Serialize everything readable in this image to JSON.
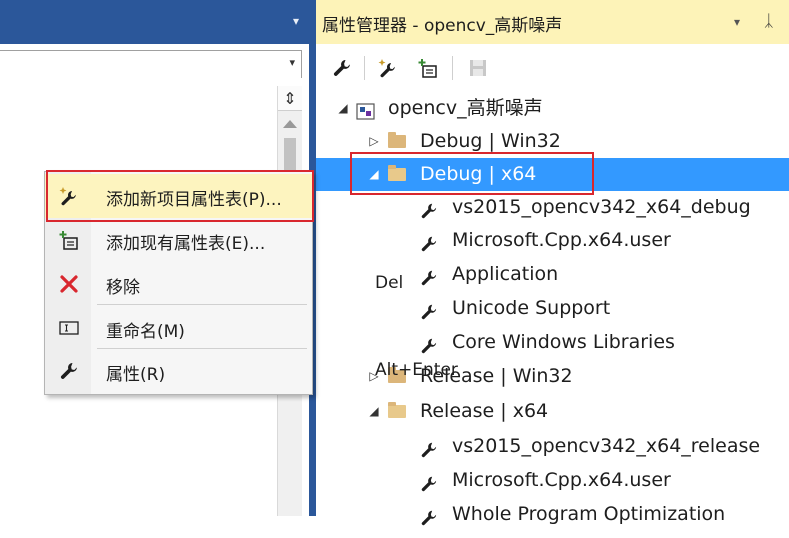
{
  "left_pane": {
    "header_dropdown": "▾",
    "combo_dropdown": "▾",
    "split_icon": "⇕"
  },
  "right_pane": {
    "title": "属性管理器 - opencv_高斯噪声",
    "title_dropdown": "▾",
    "pin": "ᛣ",
    "toolbar": [
      "wrench-icon",
      "add-new-sheet-icon",
      "add-existing-sheet-icon",
      "save-icon"
    ],
    "tree": [
      {
        "label": "opencv_高斯噪声",
        "expander": "◢",
        "icon": "project-icon"
      },
      {
        "label": "Debug | Win32",
        "expander": "▷",
        "icon": "folder-icon"
      },
      {
        "label": "Debug | x64",
        "expander": "◢",
        "icon": "folder-open-icon",
        "selected": true
      },
      {
        "label": "vs2015_opencv342_x64_debug",
        "icon": "wrench-icon"
      },
      {
        "label": "Microsoft.Cpp.x64.user",
        "icon": "wrench-icon"
      },
      {
        "label": "Application",
        "icon": "wrench-icon"
      },
      {
        "label": "Unicode Support",
        "icon": "wrench-icon"
      },
      {
        "label": "Core Windows Libraries",
        "icon": "wrench-icon"
      },
      {
        "label": "Release | Win32",
        "expander": "▷",
        "icon": "folder-icon"
      },
      {
        "label": "Release | x64",
        "expander": "◢",
        "icon": "folder-open-icon"
      },
      {
        "label": "vs2015_opencv342_x64_release",
        "icon": "wrench-icon"
      },
      {
        "label": "Microsoft.Cpp.x64.user",
        "icon": "wrench-icon"
      },
      {
        "label": "Whole Program Optimization",
        "icon": "wrench-icon"
      }
    ]
  },
  "context_menu": {
    "items": [
      {
        "label": "添加新项目属性表(P)...",
        "shortcut": "",
        "icon": "add-new-sheet-icon",
        "highlighted": true
      },
      {
        "label": "添加现有属性表(E)...",
        "shortcut": "",
        "icon": "add-existing-sheet-icon"
      },
      {
        "label": "移除",
        "shortcut": "Del",
        "icon": "remove-x-icon"
      },
      {
        "label": "重命名(M)",
        "shortcut": "",
        "icon": "rename-icon"
      },
      {
        "label": "属性(R)",
        "shortcut": "Alt+Enter",
        "icon": "wrench-icon"
      }
    ]
  },
  "colors": {
    "vs_blue": "#2b579a",
    "header_yellow": "#fdf3b8",
    "selection_blue": "#3399ff",
    "annotation_red": "#d9272e",
    "menu_hover": "#fdf4bf"
  }
}
